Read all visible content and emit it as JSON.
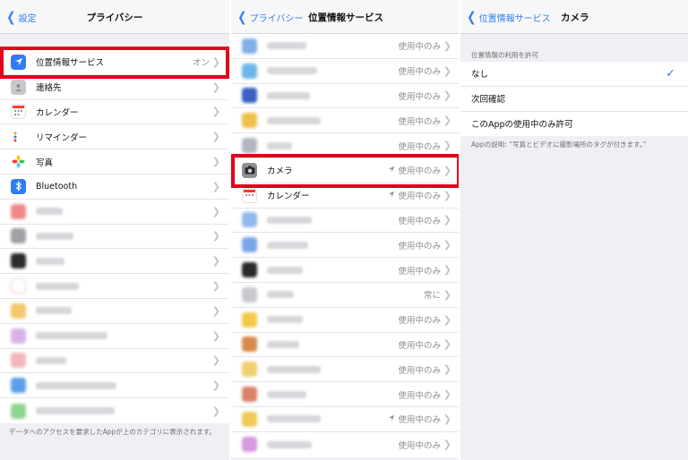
{
  "privacy": {
    "back_label": "設定",
    "title": "プライバシー",
    "items": [
      {
        "label": "位置情報サービス",
        "value": "オン",
        "icon": "location-arrow-icon",
        "color": "#2f7cf6"
      },
      {
        "label": "連絡先",
        "value": "",
        "icon": "contacts-icon",
        "color": "#b0b0b4"
      },
      {
        "label": "カレンダー",
        "value": "",
        "icon": "calendar-icon",
        "color": "#ffffff"
      },
      {
        "label": "リマインダー",
        "value": "",
        "icon": "reminders-icon",
        "color": "#ffffff"
      },
      {
        "label": "写真",
        "value": "",
        "icon": "photos-icon",
        "color": "#ffffff"
      },
      {
        "label": "Bluetooth",
        "value": "",
        "icon": "bluetooth-icon",
        "color": "#2f7cf6"
      }
    ],
    "footer": "データへのアクセスを要求したAppが上のカテゴリに表示されます。"
  },
  "location": {
    "back_label": "プライバシー",
    "title": "位置情報サービス",
    "rows": [
      {
        "label": "",
        "value": "使用中のみ",
        "arrow": false
      },
      {
        "label": "",
        "value": "使用中のみ",
        "arrow": false
      },
      {
        "label": "",
        "value": "使用中のみ",
        "arrow": false
      },
      {
        "label": "",
        "value": "使用中のみ",
        "arrow": false
      },
      {
        "label": "",
        "value": "使用中のみ",
        "arrow": false
      },
      {
        "label": "カメラ",
        "value": "使用中のみ",
        "arrow": true
      },
      {
        "label": "カレンダー",
        "value": "使用中のみ",
        "arrow": true
      },
      {
        "label": "",
        "value": "使用中のみ",
        "arrow": false
      },
      {
        "label": "",
        "value": "使用中のみ",
        "arrow": false
      },
      {
        "label": "",
        "value": "使用中のみ",
        "arrow": false
      },
      {
        "label": "",
        "value": "常に",
        "arrow": false
      },
      {
        "label": "",
        "value": "使用中のみ",
        "arrow": false
      },
      {
        "label": "",
        "value": "使用中のみ",
        "arrow": false
      },
      {
        "label": "",
        "value": "使用中のみ",
        "arrow": false
      },
      {
        "label": "",
        "value": "使用中のみ",
        "arrow": false
      },
      {
        "label": "",
        "value": "使用中のみ",
        "arrow": true
      },
      {
        "label": "",
        "value": "使用中のみ",
        "arrow": false
      }
    ]
  },
  "camera": {
    "back_label": "位置情報サービス",
    "title": "カメラ",
    "section_header": "位置情報の利用を許可",
    "options": [
      {
        "label": "なし",
        "selected": true
      },
      {
        "label": "次回確認",
        "selected": false
      },
      {
        "label": "このAppの使用中のみ許可",
        "selected": false
      }
    ],
    "description": "Appの説明: “写真とビデオに撮影場所のタグが付きます。”"
  },
  "colors": {
    "accent": "#2f7cf6",
    "highlight": "#e3001b"
  }
}
